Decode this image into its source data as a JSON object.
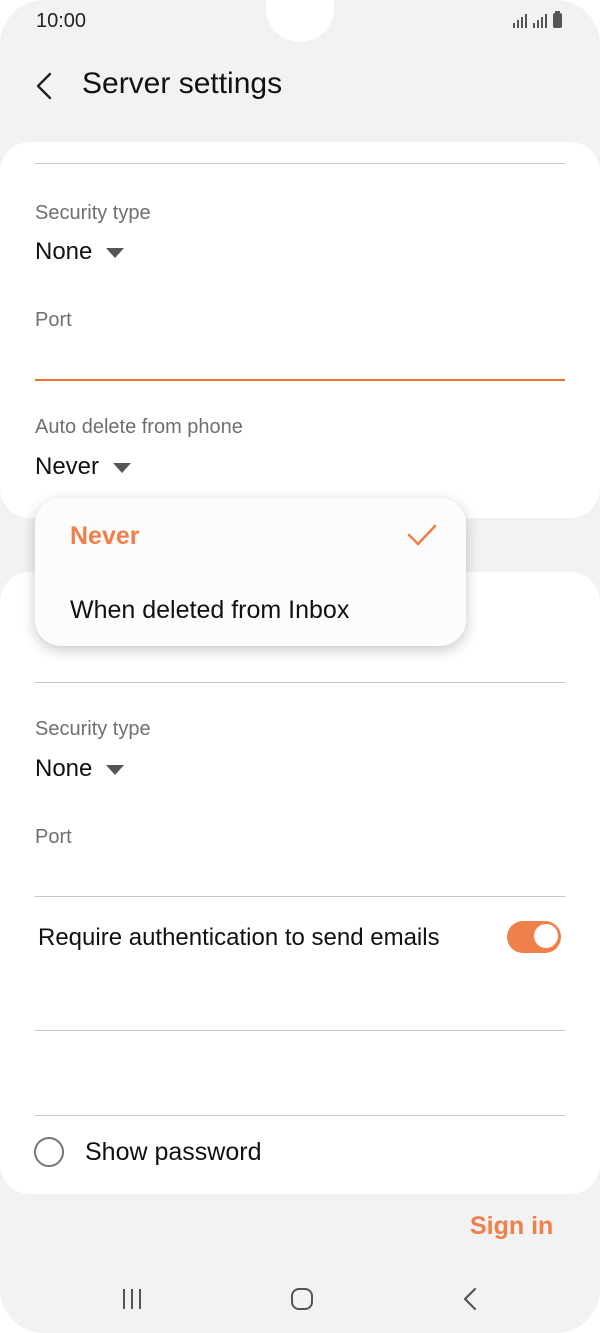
{
  "status_bar": {
    "time": "10:00"
  },
  "header": {
    "title": "Server settings",
    "back_icon": "chevron-left-icon"
  },
  "incoming": {
    "security_type_label": "Security type",
    "security_type_value": "None",
    "port_label": "Port",
    "port_value": "",
    "auto_delete_label": "Auto delete from phone",
    "auto_delete_value": "Never"
  },
  "auto_delete_dropdown": {
    "options": [
      {
        "label": "Never",
        "selected": true
      },
      {
        "label": "When deleted from Inbox",
        "selected": false
      }
    ]
  },
  "outgoing": {
    "security_type_label": "Security type",
    "security_type_value": "None",
    "port_label": "Port",
    "port_value": "",
    "require_auth_label": "Require authentication to send emails",
    "require_auth_enabled": true
  },
  "show_password": {
    "label": "Show password",
    "checked": false
  },
  "sign_in_label": "Sign in",
  "colors": {
    "accent": "#f0804a",
    "input_underline_active": "#f06f2f",
    "background": "#f2f2f2",
    "card": "#ffffff"
  }
}
